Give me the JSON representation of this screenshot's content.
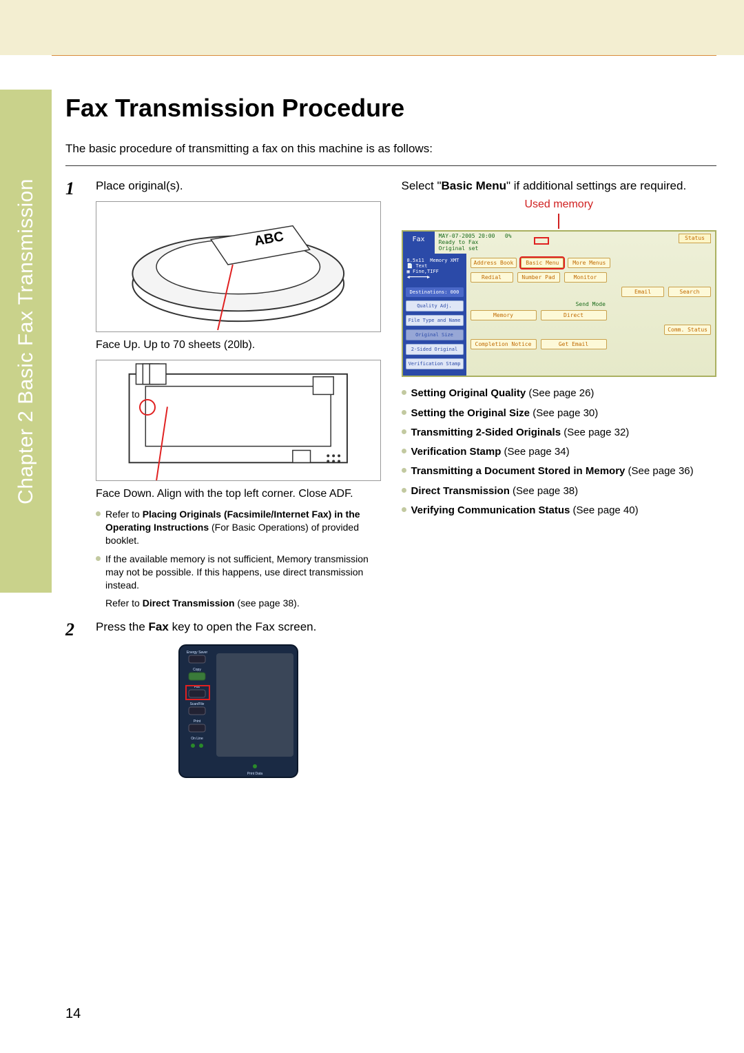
{
  "sidebar": {
    "label": "Chapter 2   Basic Fax Transmission"
  },
  "title": "Fax Transmission Procedure",
  "intro": "The basic procedure of transmitting a fax on this machine is as follows:",
  "step1": {
    "num": "1",
    "text": "Place original(s).",
    "caption_adf": "Face Up. Up to 70 sheets (20lb).",
    "abc_label": "ABC",
    "caption_glass": "Face Down. Align with the top left corner. Close ADF.",
    "notes": [
      {
        "prefix": "Refer to ",
        "bold": "Placing Originals (Facsimile/Internet Fax) in the Operating Instructions",
        "rest": " (For Basic Operations) of provided booklet."
      },
      {
        "plain": "If the available memory is not sufficient, Memory transmission may not be possible. If this happens, use direct transmission instead."
      }
    ],
    "ref_prefix": "Refer to ",
    "ref_bold": "Direct Transmission",
    "ref_rest": " (see page 38)."
  },
  "step2": {
    "num": "2",
    "pre": "Press the ",
    "bold": "Fax",
    "post": " key to open the Fax screen.",
    "panel": {
      "keys": [
        "Energy Saver",
        "Copy",
        "Fax",
        "Scan/File",
        "Print",
        "On Line"
      ],
      "bottom": "Print Data"
    }
  },
  "right": {
    "select_pre": "Select \"",
    "select_bold": "Basic Menu",
    "select_post": "\" if additional settings are required.",
    "used_memory_label": "Used memory",
    "screen": {
      "tab": "Fax",
      "date": "MAY-07-2005  20:00",
      "pct": "0%",
      "status_btn": "Status",
      "line2": "Ready to Fax",
      "line3": "Original set",
      "side_top1": "8.5x11",
      "side_top2": "Memory XMT",
      "side_top3": "Text",
      "side_top4": "Fine,TIFF",
      "dest": "Destinations: 000",
      "side_items": [
        "Quality Adj.",
        "File Type and Name",
        "Original Size",
        "2-Sided Original",
        "Verification Stamp"
      ],
      "row1": [
        "Address Book",
        "Basic Menu",
        "More Menus"
      ],
      "row2": [
        "Redial",
        "Number Pad",
        "Monitor"
      ],
      "row3": [
        "Email",
        "Search"
      ],
      "send_mode": "Send Mode",
      "row4": [
        "Memory",
        "Direct"
      ],
      "row5_right": "Comm. Status",
      "row6": [
        "Completion Notice",
        "Get Email"
      ]
    },
    "features": [
      {
        "bold": "Setting Original Quality",
        "rest": " (See page 26)"
      },
      {
        "bold": "Setting the Original Size",
        "rest": " (See page 30)"
      },
      {
        "bold": "Transmitting 2-Sided Originals",
        "rest": " (See page 32)"
      },
      {
        "bold": "Verification Stamp",
        "rest": " (See page 34)"
      },
      {
        "bold": "Transmitting a Document Stored in Memory",
        "rest": " (See page 36)"
      },
      {
        "bold": "Direct Transmission",
        "rest": " (See page 38)"
      },
      {
        "bold": "Verifying Communication Status",
        "rest": " (See page 40)"
      }
    ]
  },
  "page_number": "14"
}
